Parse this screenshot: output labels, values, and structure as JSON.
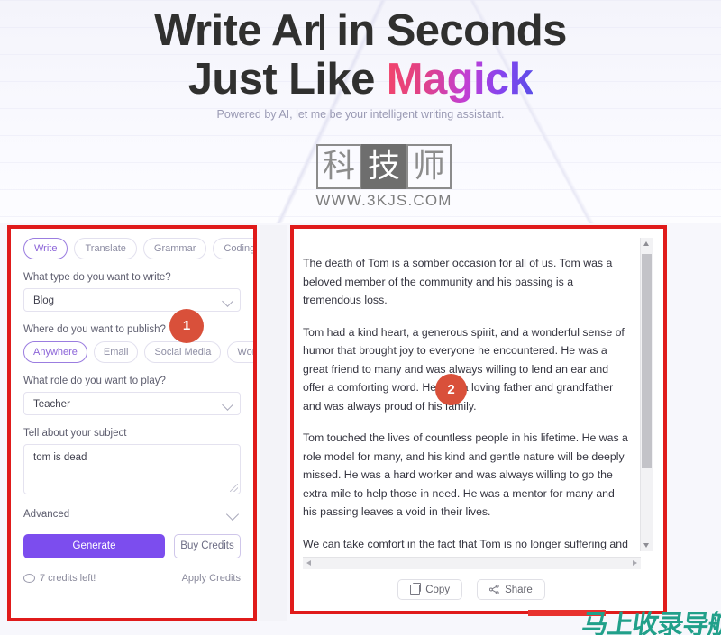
{
  "hero": {
    "title_line1_a": "Write Ar",
    "title_line1_b": " in Seconds",
    "title_line2_plain": "Just Like ",
    "title_line2_accent": "Magick",
    "subtitle": "Powered by AI, let me be your intelligent writing assistant.",
    "accent_gradient_start": "#f2456b",
    "accent_gradient_mid": "#c13fd4",
    "accent_gradient_end": "#5b4ee8"
  },
  "logo": {
    "char1": "科",
    "char2": "技",
    "char3": "师",
    "url": "WWW.3KJS.COM"
  },
  "left_panel": {
    "mode_tabs": [
      {
        "label": "Write",
        "active": true
      },
      {
        "label": "Translate",
        "active": false
      },
      {
        "label": "Grammar",
        "active": false
      },
      {
        "label": "Coding",
        "active": false
      }
    ],
    "type_label": "What type do you want to write?",
    "type_value": "Blog",
    "publish_label": "Where do you want to publish?",
    "publish_options": [
      {
        "label": "Anywhere",
        "active": true
      },
      {
        "label": "Email",
        "active": false
      },
      {
        "label": "Social Media",
        "active": false
      },
      {
        "label": "Work",
        "active": false
      }
    ],
    "role_label": "What role do you want to play?",
    "role_value": "Teacher",
    "subject_label": "Tell about your subject",
    "subject_value": "tom is dead",
    "subject_placeholder": "Tell about your subject",
    "advanced_label": "Advanced",
    "generate_label": "Generate",
    "buy_credits_label": "Buy Credits",
    "credits_text": "7 credits left!",
    "apply_credits_label": "Apply Credits",
    "accent_color": "#7c4dee"
  },
  "right_panel": {
    "paragraphs": [
      "The death of Tom is a somber occasion for all of us. Tom was a beloved member of the community and his passing is a tremendous loss.",
      "Tom had a kind heart, a generous spirit, and a wonderful sense of humor that brought joy to everyone he encountered. He was a great friend to many and was always willing to lend an ear and offer a comforting word. He was a loving father and grandfather and was always proud of his family.",
      "Tom touched the lives of countless people in his lifetime. He was a role model for many, and his kind and gentle nature will be deeply missed. He was a hard worker and was always willing to go the extra mile to help those in need. He was a mentor for many and his passing leaves a void in their lives.",
      "We can take comfort in the fact that Tom is no longer suffering and is now in a better place. We should take solace in the fact that he is no longer in pain and can now rest peacefully."
    ],
    "copy_label": "Copy",
    "share_label": "Share"
  },
  "annotations": {
    "badge_1": "1",
    "badge_2": "2",
    "box_color": "#e01b1b",
    "badge_color": "#d9503a"
  },
  "watermark": {
    "text": "马上收录导航",
    "text_color": "#21a08a",
    "bar_color": "#e8322e"
  }
}
